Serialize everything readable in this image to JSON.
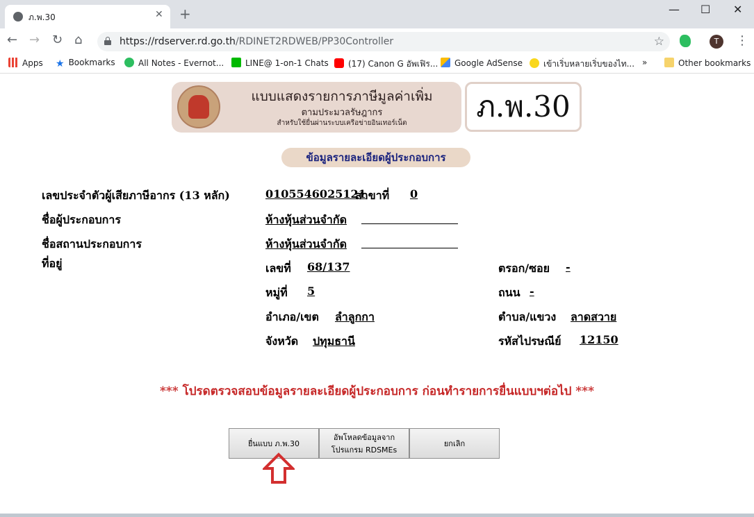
{
  "browser": {
    "tab_title": "ภ.พ.30",
    "tab_close": "✕",
    "new_tab": "+",
    "window": {
      "minimize": "—",
      "maximize": "☐",
      "close": "✕"
    },
    "nav": {
      "back": "←",
      "forward": "→",
      "reload": "↻",
      "home": "⌂"
    },
    "url_host": "https://rdserver.rd.go.th",
    "url_path": "/RDINET2RDWEB/PP30Controller",
    "avatar_letter": "T",
    "menu": "⋮",
    "star": "☆",
    "bookmarks": [
      {
        "label": "Apps",
        "icon": "apps-grid-icon"
      },
      {
        "label": "Bookmarks",
        "icon": "star-icon"
      },
      {
        "label": "All Notes - Evernot...",
        "icon": "evernote-icon"
      },
      {
        "label": "LINE@ 1-on-1 Chats",
        "icon": "line-icon"
      },
      {
        "label": "(17) Canon G อัพเฟิร...",
        "icon": "youtube-icon"
      },
      {
        "label": "Google AdSense",
        "icon": "adsense-icon"
      },
      {
        "label": "เข้าเริ่บหลายเริ่บของไท...",
        "icon": "emoji-icon"
      }
    ],
    "bookmarks_more": "»",
    "other_bookmarks": "Other bookmarks"
  },
  "header": {
    "title": "แบบแสดงรายการภาษีมูลค่าเพิ่ม",
    "subtitle1": "ตามประมวลรัษฎากร",
    "subtitle2": "สำหรับใช้ยื่นผ่านระบบเครือข่ายอินเทอร์เน็ต",
    "form_code": "ภ.พ.30"
  },
  "section_title": "ข้อมูลรายละเอียดผู้ประกอบการ",
  "taxpayer": {
    "tax_id_label": "เลขประจำตัวผู้เสียภาษีอากร (13 หลัก)",
    "tax_id_value": "0105546025121",
    "branch_label": "สาขาที่",
    "branch_value": "0",
    "name_label": "ชื่อผู้ประกอบการ",
    "name_value": "ห้างหุ้นส่วนจำกัด",
    "place_label": "ชื่อสถานประกอบการ",
    "place_value": "ห้างหุ้นส่วนจำกัด",
    "address_label": "ที่อยู่"
  },
  "address": {
    "no_label": "เลขที่",
    "no_value": "68/137",
    "soi_label": "ตรอก/ซอย",
    "soi_value": "-",
    "moo_label": "หมู่ที่",
    "moo_value": "5",
    "road_label": "ถนน",
    "road_value": "-",
    "district_label": "อำเภอ/เขต",
    "district_value": "ลำลูกกา",
    "subdistrict_label": "ตำบล/แขวง",
    "subdistrict_value": "ลาดสวาย",
    "province_label": "จังหวัด",
    "province_value": "ปทุมธานี",
    "zip_label": "รหัสไปรษณีย์",
    "zip_value": "12150"
  },
  "warning": "*** โปรดตรวจสอบข้อมูลรายละเอียดผู้ประกอบการ ก่อนทำรายการยื่นแบบฯต่อไป ***",
  "buttons": {
    "submit": "ยื่นแบบ ภ.พ.30",
    "upload_line1": "อัพโหลดข้อมูลจาก",
    "upload_line2": "โปรแกรม RDSMEs",
    "cancel": "ยกเลิก"
  },
  "colors": {
    "warning": "#c62828",
    "arrow": "#d32f2f",
    "section_text": "#1a237e"
  }
}
